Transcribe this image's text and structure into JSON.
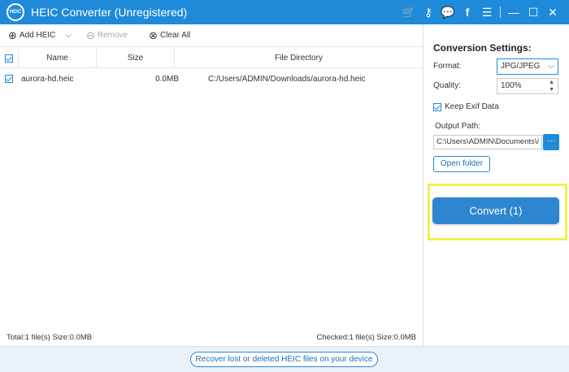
{
  "window": {
    "logo_text": "HEIC",
    "title": "HEIC Converter (Unregistered)",
    "icons": [
      "cart-icon",
      "key-icon",
      "chat-icon",
      "facebook-icon",
      "menu-icon",
      "minimize-icon",
      "maximize-icon",
      "close-icon"
    ]
  },
  "toolbar": {
    "add_label": "Add HEIC",
    "remove_label": "Remove",
    "clear_label": "Clear All"
  },
  "table": {
    "headers": {
      "name": "Name",
      "size": "Size",
      "dir": "File Directory"
    },
    "rows": [
      {
        "name": "aurora-hd.heic",
        "size": "0.0MB",
        "dir": "C:/Users/ADMIN/Downloads/aurora-hd.heic",
        "checked": true
      }
    ]
  },
  "settings": {
    "title": "Conversion Settings:",
    "format_label": "Format:",
    "format_value": "JPG/JPEG",
    "quality_label": "Quality:",
    "quality_value": "100%",
    "keep_exif_label": "Keep Exif Data",
    "output_label": "Output Path:",
    "output_value": "C:\\Users\\ADMIN\\Documents\\/",
    "open_folder_label": "Open folder",
    "convert_label": "Convert (1)"
  },
  "status": {
    "total": "Total:1 file(s) Size:0.0MB",
    "checked": "Checked:1 file(s) Size:0.0MB"
  },
  "footer": {
    "recover_label": "Recover lost or deleted HEIC files on your device"
  },
  "colors": {
    "brand": "#1f8ad9",
    "highlight": "#f0f050"
  }
}
